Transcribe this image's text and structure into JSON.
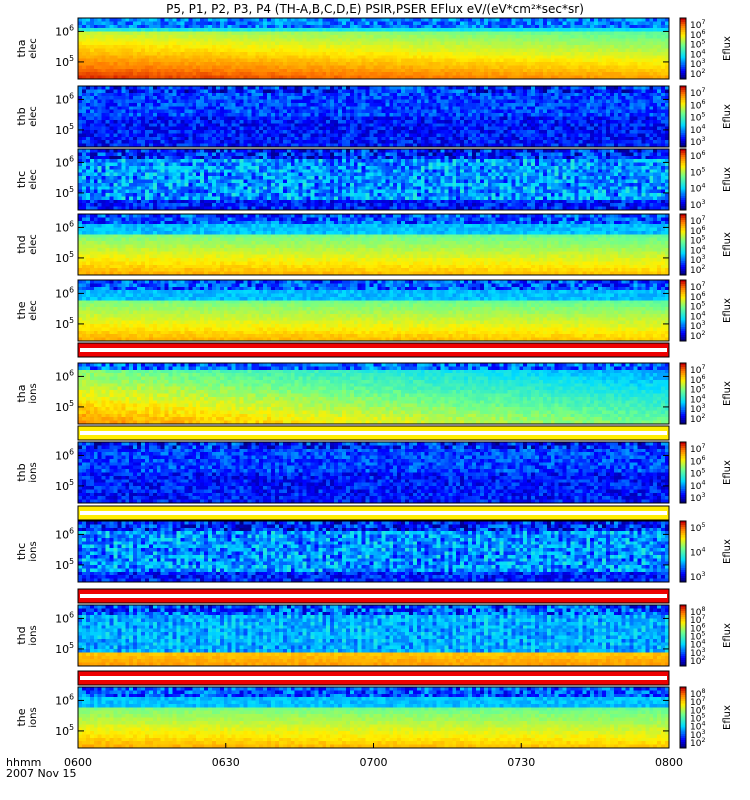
{
  "title": "P5, P1, P2, P3, P4 (TH-A,B,C,D,E) PSIR,PSER EFlux eV/(eV*cm²*sec*sr)",
  "chart_data": {
    "type": "heatmap",
    "x_ticks": [
      "0600",
      "0630",
      "0700",
      "0730",
      "0800"
    ],
    "x_axis_label": "hhmm",
    "date_label": "2007 Nov 15",
    "colorbar_label": "Eflux",
    "panels": [
      {
        "id": "tha-elec",
        "probe": "tha",
        "species": "elec",
        "y_ticks": [
          "10^6",
          "10^5"
        ],
        "cbar_ticks": [
          "10^7",
          "10^6",
          "10^5",
          "10^4",
          "10^3",
          "10^2"
        ],
        "style": "strong"
      },
      {
        "id": "thb-elec",
        "probe": "thb",
        "species": "elec",
        "y_ticks": [
          "10^6",
          "10^5"
        ],
        "cbar_ticks": [
          "10^7",
          "10^6",
          "10^5",
          "10^4",
          "10^3"
        ],
        "style": "noisy"
      },
      {
        "id": "thc-elec",
        "probe": "thc",
        "species": "elec",
        "y_ticks": [
          "10^6",
          "10^5"
        ],
        "cbar_ticks": [
          "10^6",
          "10^5",
          "10^4",
          "10^3"
        ],
        "style": "noisyband"
      },
      {
        "id": "thd-elec",
        "probe": "thd",
        "species": "elec",
        "y_ticks": [
          "10^6",
          "10^5"
        ],
        "cbar_ticks": [
          "10^7",
          "10^6",
          "10^5",
          "10^4",
          "10^3",
          "10^2"
        ],
        "style": "medium"
      },
      {
        "id": "the-elec",
        "probe": "the",
        "species": "elec",
        "y_ticks": [
          "10^6",
          "10^5"
        ],
        "cbar_ticks": [
          "10^7",
          "10^6",
          "10^5",
          "10^4",
          "10^3",
          "10^2"
        ],
        "style": "medium"
      },
      {
        "id": "tha-ions",
        "probe": "tha",
        "species": "ions",
        "y_ticks": [
          "10^6",
          "10^5"
        ],
        "cbar_ticks": [
          "10^7",
          "10^6",
          "10^5",
          "10^4",
          "10^3",
          "10^2"
        ],
        "style": "ionstrong",
        "bar": "red"
      },
      {
        "id": "thb-ions",
        "probe": "thb",
        "species": "ions",
        "y_ticks": [
          "10^6",
          "10^5"
        ],
        "cbar_ticks": [
          "10^7",
          "10^6",
          "10^5",
          "10^4",
          "10^3"
        ],
        "style": "noisy",
        "bar": "yellow"
      },
      {
        "id": "thc-ions",
        "probe": "thc",
        "species": "ions",
        "y_ticks": [
          "10^6",
          "10^5"
        ],
        "cbar_ticks": [
          "10^5",
          "10^4",
          "10^3"
        ],
        "style": "noisyband",
        "bar": "yellow"
      },
      {
        "id": "thd-ions",
        "probe": "thd",
        "species": "ions",
        "y_ticks": [
          "10^6",
          "10^5"
        ],
        "cbar_ticks": [
          "10^8",
          "10^7",
          "10^6",
          "10^5",
          "10^4",
          "10^3",
          "10^2"
        ],
        "style": "weak",
        "bar": "red"
      },
      {
        "id": "the-ions",
        "probe": "the",
        "species": "ions",
        "y_ticks": [
          "10^6",
          "10^5"
        ],
        "cbar_ticks": [
          "10^8",
          "10^7",
          "10^6",
          "10^5",
          "10^4",
          "10^3",
          "10^2"
        ],
        "style": "medium",
        "bar": "red"
      }
    ]
  }
}
